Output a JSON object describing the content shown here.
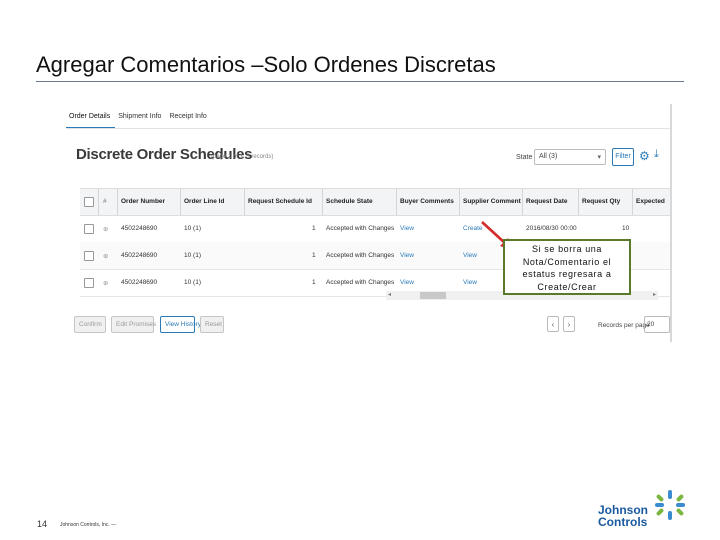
{
  "slide": {
    "title": "Agregar Comentarios –Solo Ordenes Discretas",
    "page_number": "14",
    "footer": "Johnson Controls, Inc. —",
    "logo_line1": "Johnson",
    "logo_line2": "Controls"
  },
  "app": {
    "tabs": [
      {
        "label": "Order Details",
        "active": true
      },
      {
        "label": "Shipment Info",
        "active": false
      },
      {
        "label": "Receipt Info",
        "active": false
      }
    ],
    "heading": "Discrete Order Schedules",
    "subheading": "(page 1 of 1, 3 records)",
    "state_label": "State",
    "state_value": "All (3)",
    "filter_label": "Filter",
    "icons": {
      "settings": "gear-icon",
      "download": "download-icon",
      "chevron": "chevron-down-icon"
    },
    "columns": [
      "Order Number",
      "Order Line Id",
      "Request Schedule Id",
      "Schedule State",
      "Buyer Comments",
      "Supplier Comment",
      "Request Date",
      "Request Qty",
      "Expected"
    ],
    "rows": [
      {
        "order": "4502248690",
        "line": "10 (1)",
        "sched": "1",
        "state": "Accepted with Changes",
        "buyer": "View",
        "supplier": "Create",
        "date": "2016/08/30 00:00",
        "qty": "10"
      },
      {
        "order": "4502248690",
        "line": "10 (1)",
        "sched": "1",
        "state": "Accepted with Changes",
        "buyer": "View",
        "supplier": "View",
        "date": "",
        "qty": ""
      },
      {
        "order": "4502248690",
        "line": "10 (1)",
        "sched": "1",
        "state": "Accepted with Changes",
        "buyer": "View",
        "supplier": "View",
        "date": "",
        "qty": ""
      }
    ],
    "buttons": {
      "confirm": "Confirm",
      "edit_promises": "Edit Promises",
      "view_history": "View History",
      "reset": "Reset"
    },
    "pager": {
      "prev": "‹",
      "next": "›",
      "records_label": "Records per page",
      "records_value": "20"
    }
  },
  "callout": {
    "text": "Si se borra una Nota/Comentario el estatus regresara a Create/Crear",
    "border_color": "#5a7a2a",
    "arrow_color": "#d42a2a"
  },
  "colors": {
    "accent": "#2a7ab8",
    "brand": "#1a5aa0"
  }
}
